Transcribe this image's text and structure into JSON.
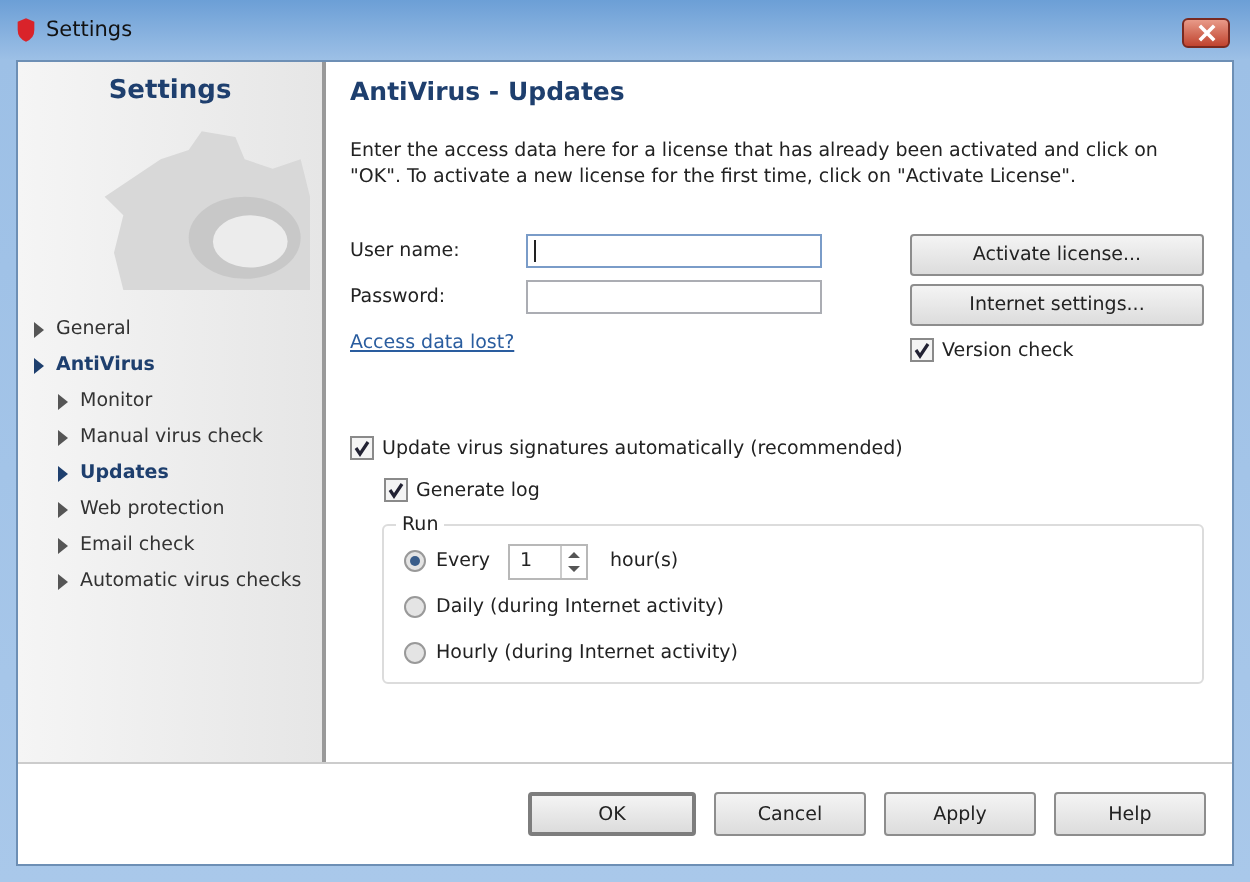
{
  "window": {
    "title": "Settings"
  },
  "sidebar": {
    "title": "Settings",
    "items": [
      {
        "label": "General",
        "selected": false
      },
      {
        "label": "AntiVirus",
        "selected": true,
        "children": [
          {
            "label": "Monitor",
            "selected": false
          },
          {
            "label": "Manual virus check",
            "selected": false
          },
          {
            "label": "Updates",
            "selected": true
          },
          {
            "label": "Web protection",
            "selected": false
          },
          {
            "label": "Email check",
            "selected": false
          },
          {
            "label": "Automatic virus checks",
            "selected": false
          }
        ]
      }
    ]
  },
  "page": {
    "title": "AntiVirus - Updates",
    "description": "Enter the access data here for a license that has already been activated and click on \"OK\". To activate a new license for the first time, click on \"Activate License\".",
    "fields": [
      {
        "label": "User name:",
        "focused": true
      },
      {
        "label": "Password:",
        "focused": false
      }
    ],
    "side_buttons": [
      "Activate license...",
      "Internet settings..."
    ],
    "link": "Access data lost?",
    "version_check": {
      "label": "Version check",
      "checked": true
    },
    "auto_update": {
      "label": "Update virus signatures automatically (recommended)",
      "checked": true
    },
    "generate_log": {
      "label": "Generate log",
      "checked": true
    },
    "run": {
      "title": "Run",
      "options": [
        {
          "kind": "interval",
          "label": "Every",
          "value": "1",
          "unit": "hour(s)",
          "selected": true
        },
        {
          "kind": "plain",
          "label": "Daily (during Internet activity)",
          "selected": false
        },
        {
          "kind": "plain",
          "label": "Hourly (during Internet activity)",
          "selected": false
        }
      ]
    }
  },
  "buttons": [
    {
      "label": "OK",
      "default": true
    },
    {
      "label": "Cancel",
      "default": false
    },
    {
      "label": "Apply",
      "default": false
    },
    {
      "label": "Help",
      "default": false
    }
  ]
}
